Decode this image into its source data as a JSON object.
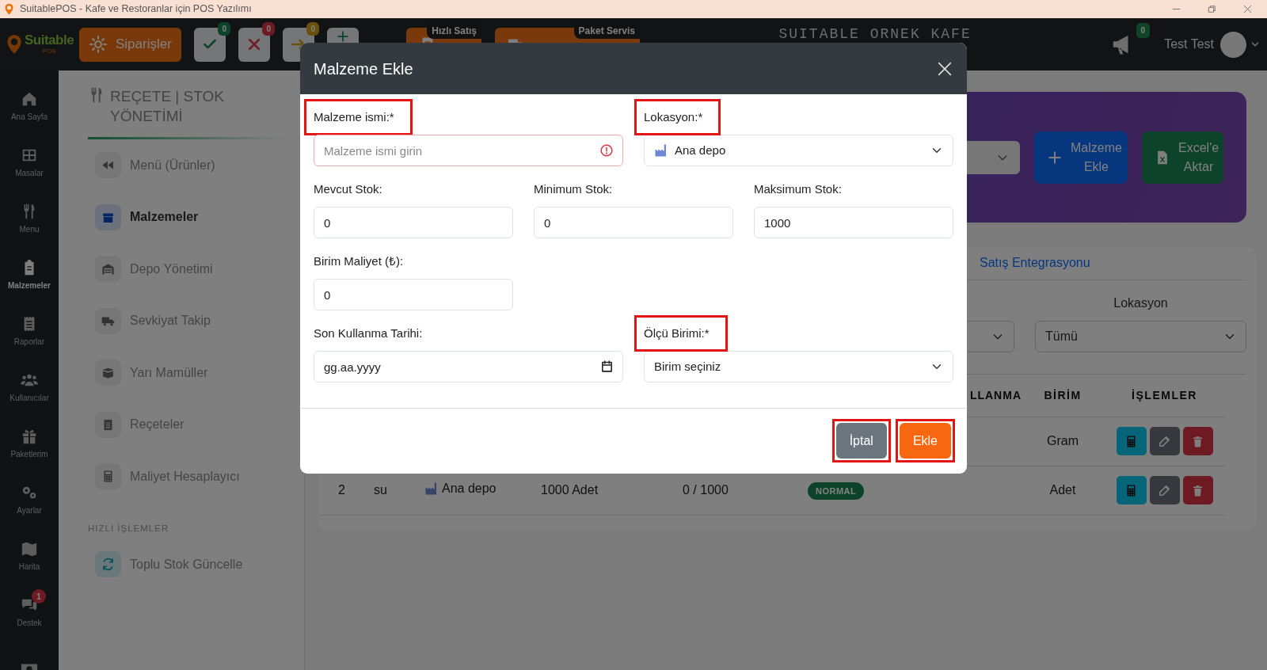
{
  "window": {
    "title": "SuitablePOS - Kafe ve Restoranlar için POS Yazılımı"
  },
  "navbar": {
    "logo_text": "Suitable",
    "logo_subtext": "POS",
    "orders_button": "Siparişler",
    "quick_buttons": [
      {
        "kind": "approve",
        "badge": "0"
      },
      {
        "kind": "cancel",
        "badge": "0"
      },
      {
        "kind": "forward",
        "badge": "0"
      },
      {
        "kind": "add"
      }
    ],
    "mode_buttons": [
      {
        "kind": "quick_sale",
        "tag": "Hızlı Satış"
      },
      {
        "kind": "delivery",
        "tag": "Paket Servis"
      }
    ],
    "cafe_name": "SUITABLE ORNEK KAFE",
    "announcements_badge": "0",
    "user_name": "Test Test"
  },
  "sidebar": {
    "items": [
      {
        "kind": "home",
        "label": "Ana Sayfa",
        "selected": false
      },
      {
        "kind": "tables",
        "label": "Masalar",
        "selected": false
      },
      {
        "kind": "utensils",
        "label": "Menu",
        "selected": false
      },
      {
        "kind": "clipboard",
        "label": "Malzemeler",
        "selected": true
      },
      {
        "kind": "receipt",
        "label": "Raporlar",
        "selected": false
      },
      {
        "kind": "users",
        "label": "Kullanıcılar",
        "selected": false
      },
      {
        "kind": "gift",
        "label": "Paketlerim",
        "selected": false
      },
      {
        "kind": "gears",
        "label": "Ayarlar",
        "selected": false
      },
      {
        "kind": "map",
        "label": "Harita",
        "selected": false
      },
      {
        "kind": "chat",
        "label": "Destek",
        "selected": false,
        "badge": "1"
      },
      {
        "kind": "cash",
        "selected": false
      }
    ]
  },
  "section_menu": {
    "title": "REÇETE | STOK YÖNETİMİ",
    "items": [
      {
        "kind": "rewind",
        "label": "Menü (Ürünler)",
        "selected": false
      },
      {
        "kind": "box",
        "label": "Malzemeler",
        "selected": true
      },
      {
        "kind": "warehouse",
        "label": "Depo Yönetimi",
        "selected": false
      },
      {
        "kind": "truck",
        "label": "Sevkiyat Takip",
        "selected": false
      },
      {
        "kind": "openbox",
        "label": "Yarı Mamüller",
        "selected": false
      },
      {
        "kind": "receipt",
        "label": "Reçeteler",
        "selected": false
      },
      {
        "kind": "calculator",
        "label": "Maliyet Hesaplayıcı",
        "selected": false
      }
    ],
    "quick_title": "HIZLI İŞLEMLER",
    "quick_items": [
      {
        "kind": "refresh",
        "label": "Toplu Stok Güncelle"
      }
    ]
  },
  "header_card": {
    "buttons": [
      {
        "kind": "add",
        "label": "Malzeme Ekle"
      },
      {
        "kind": "excel",
        "label": "Excel'e Aktar"
      }
    ]
  },
  "list_card": {
    "tabs": [
      {
        "label": "Satış Entegrasyonu",
        "selected": false
      }
    ],
    "location_filter": {
      "label": "Lokasyon",
      "value": "Tümü"
    },
    "table": {
      "columns": [
        "LLANMA",
        "BİRİM",
        "İŞLEMLER"
      ],
      "rows": [
        {
          "unit": "Gram"
        },
        {
          "no": "2",
          "name": "su",
          "location": "Ana depo",
          "stock": "1000 Adet",
          "min_max": "0 / 1000",
          "status": "NORMAL",
          "unit": "Adet"
        }
      ]
    }
  },
  "modal": {
    "title": "Malzeme Ekle",
    "rows": [
      {
        "fields": [
          {
            "kind": "text",
            "label": "Malzeme ismi:*",
            "placeholder": "Malzeme ismi girin",
            "invalid": true,
            "highlighted": true
          },
          {
            "kind": "location_select",
            "label": "Lokasyon:*",
            "value": "Ana depo",
            "highlighted": true
          }
        ]
      },
      {
        "fields": [
          {
            "kind": "number",
            "label": "Mevcut Stok:",
            "value": "0",
            "highlighted": false
          },
          {
            "kind": "number",
            "label": "Minimum Stok:",
            "value": "0",
            "highlighted": false
          },
          {
            "kind": "number",
            "label": "Maksimum Stok:",
            "value": "1000",
            "highlighted": false
          }
        ]
      },
      {
        "fields": [
          {
            "kind": "number",
            "label": "Birim Maliyet (₺):",
            "value": "0",
            "highlighted": false
          }
        ]
      },
      {
        "fields": [
          {
            "kind": "date",
            "label": "Son Kullanma Tarihi:",
            "placeholder": "gg.aa.yyyy",
            "highlighted": false
          },
          {
            "kind": "select",
            "label": "Ölçü Birimi:*",
            "value": "Birim seçiniz",
            "highlighted": true
          }
        ]
      }
    ],
    "buttons": [
      {
        "kind": "cancel",
        "label": "İptal",
        "highlighted": true
      },
      {
        "kind": "submit",
        "label": "Ekle",
        "highlighted": true
      }
    ]
  }
}
